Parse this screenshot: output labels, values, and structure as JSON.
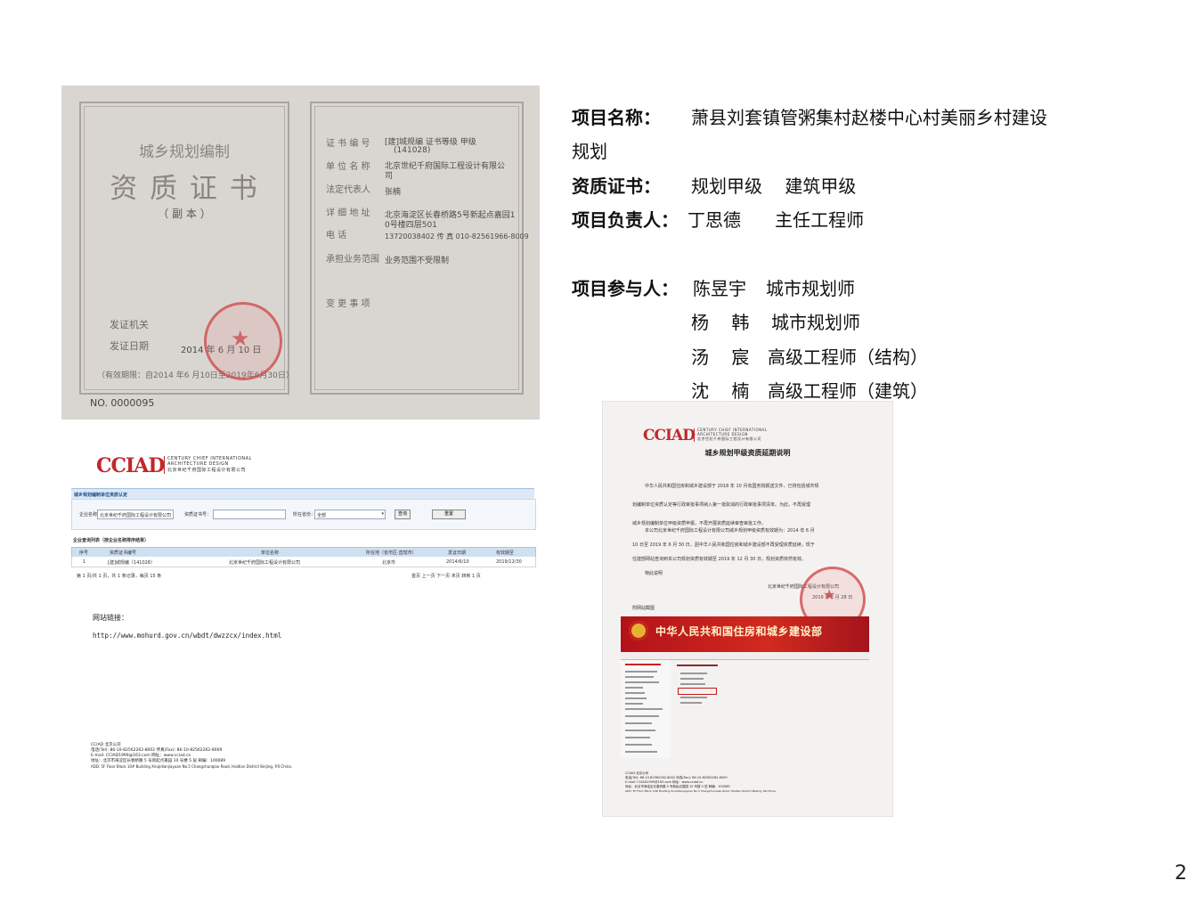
{
  "page_number": "2",
  "info": {
    "project_name_label": "项目名称：",
    "project_name_line1": "萧县刘套镇管粥集村赵楼中心村美丽乡村建设",
    "project_name_line2": "规划",
    "qualification_label": "资质证书：",
    "qualification_value": "规划甲级    建筑甲级",
    "leader_label": "项目负责人：",
    "leader_value": "丁思德      主任工程师",
    "participants_label": "项目参与人：",
    "participants": [
      {
        "name": "陈昱宇",
        "title": "城市规划师"
      },
      {
        "name": "杨    韩",
        "title": "城市规划师"
      },
      {
        "name": "汤    宸",
        "title": "高级工程师（结构）"
      },
      {
        "name": "沈    楠",
        "title": "高级工程师（建筑）"
      }
    ]
  },
  "certificate": {
    "heading_small": "城乡规划编制",
    "heading_big": "资 质 证 书",
    "copy_label": "（ 副 本 ）",
    "issuer_label": "发证机关",
    "issue_date_label": "发证日期",
    "issue_date_value": "2014 年  6  月 10  日",
    "validity": "（有效期限：自2014 年6 月10日至2019年6月30日）",
    "serial": "NO. 0000095",
    "fields": [
      {
        "label": "证 书 编 号",
        "value": "[建]城规编  证书等级  甲级"
      },
      {
        "label": "",
        "value": "(141028)"
      },
      {
        "label": "单 位 名 称",
        "value": "北京世纪千府国际工程设计有限公"
      },
      {
        "label": "",
        "value": "司"
      },
      {
        "label": "法定代表人",
        "value": "张楠"
      },
      {
        "label": "详 细 地 址",
        "value": "北京海淀区长春桥路5号新起点嘉园1"
      },
      {
        "label": "",
        "value": "0号楼四层501"
      },
      {
        "label": "电          话",
        "value": "13720038402  传  真  010-82561966-8009"
      },
      {
        "label": "承担业务范围",
        "value": "业务范围不受限制"
      },
      {
        "label": "变 更 事 项",
        "value": ""
      }
    ]
  },
  "web_query": {
    "logo_mark": "CCIAD",
    "logo_en_1": "CENTURY CHIEF INTERNATIONAL",
    "logo_en_2": "ARCHITECTURE DESIGN",
    "logo_cn": "北京世纪千府国际工程设计有限公司",
    "section_title": "城乡规划编制单位资质认定",
    "company_label": "企业名称：",
    "company_value": "北京世纪千府国际工程设计有限公司",
    "cert_no_label": "资质证书号：",
    "region_label": "所在省份：",
    "region_value": "全部",
    "search_btn": "查询",
    "reset_btn": "重置",
    "list_title": "企业查询列表（按企业名称排序结果）",
    "table_headers": [
      "序号",
      "资质证书编号",
      "单位名称",
      "所在地（省市区·直辖市）",
      "发证日期",
      "有效期至"
    ],
    "table_row": [
      "1",
      "[建]城规编（141028）",
      "北京世纪千府国际工程设计有限公司",
      "北京市",
      "2014/6/10",
      "2019/12/30"
    ],
    "pager": "第 1 页/共 1 页，共 1 条记录，每页 15 条",
    "pager_right": "首页 上一页 下一页 末页 转到 1 页",
    "link_label": "网站链接：",
    "link_url": "http://www.mohurd.gov.cn/wbdt/dwzzcx/index.html",
    "footer_lines": [
      "CCIAD 北京公司",
      "电话(Tel): 86-10-82562262-8002    传真(Fax): 86-10-82562262-8009",
      "E-mail: CCIAD1999@163.com           网址：www.cciad.cn",
      "地址：北京市海淀区长春桥路 5 号新起点嘉园 10 号楼 5 层    邮编：100089",
      "ADD: 5F Floor Block 10# Building Xinqidianjiayuan No.5 Changchunqiao Road, Haidian District Beijing, P.R.China."
    ]
  },
  "letter": {
    "logo_mark": "CCIAD",
    "title": "城乡规划甲级资质延期说明",
    "paragraph1": [
      "中华人民共和国住房和城乡建设部于 2018 年 10 月向国务院报送文件，已将包括城市规",
      "划编制单位资质认定等行政审批事项纳入第一批取消的行政审批事项清单。为此，不再受理",
      "城乡规划编制单位甲级资质申报，不再开展资质延续审查审批工作。"
    ],
    "paragraph2": [
      "本公司北京世纪千府国际工程设计有限公司城乡规划甲级资质有效期为：2014 年 6 月",
      "10 日至 2019 年 6 月 30 日，因中华人民共和国住房和城乡建设部不再受理资质延续，现于",
      "住建部网站查询到本公司规划资质有效期至 2019 年 12 月 30 日，规划资质依然有效。"
    ],
    "closing": "特此说明",
    "signer": "北京世纪千府国际工程设计有限公司",
    "sign_date": "2019 年 6 月 28 日",
    "attachment_label": "附网站截图",
    "banner_title": "中华人民共和国住房和城乡建设部",
    "footer_lines": [
      "CCIAD 北京公司",
      "电话(Tel): 86-10-82562262-8002    传真(Fax): 86-10-82562262-8009",
      "E-mail: CCIAD1999@163.com     网址：www.cciad.cn",
      "地址：北京市海淀区长春桥路 5 号新起点嘉园 10 号楼 5 层    邮编：100089",
      "ADD: 5F Floor Block 10# Building Xinqidianjiayuan No.5 Changchunqiao Road, Haidian District Beijing, P.R.China."
    ]
  }
}
